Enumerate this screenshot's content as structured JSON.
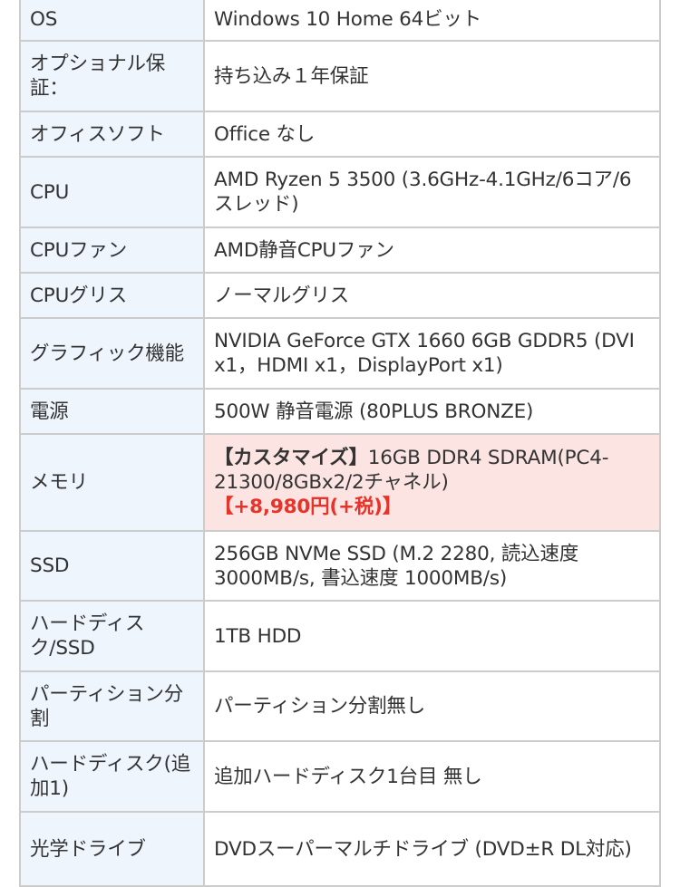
{
  "spec_table": {
    "colors": {
      "label_bg": "#eef5fd",
      "highlight_bg": "#fbe4e1",
      "price_red": "#e8332a",
      "border": "#cccccc"
    },
    "rows": [
      {
        "label": "OS",
        "value": "Windows 10 Home 64ビット"
      },
      {
        "label": "オプショナル保証：",
        "value": "持ち込み１年保証"
      },
      {
        "label": "オフィスソフト",
        "value": "Office なし"
      },
      {
        "label": "CPU",
        "value": "AMD Ryzen 5 3500 (3.6GHz-4.1GHz/6コア/6スレッド)"
      },
      {
        "label": "CPUファン",
        "value": "AMD静音CPUファン"
      },
      {
        "label": "CPUグリス",
        "value": "ノーマルグリス"
      },
      {
        "label": "グラフィック機能",
        "value": "NVIDIA GeForce GTX 1660 6GB GDDR5 (DVI x1，HDMI x1，DisplayPort x1)"
      },
      {
        "label": "電源",
        "value": "500W 静音電源 (80PLUS BRONZE)"
      },
      {
        "label": "メモリ",
        "customize_tag": "【カスタマイズ】",
        "value": "16GB DDR4 SDRAM(PC4-21300/8GBx2/2チャネル)",
        "price": "【+8,980円(+税)】",
        "highlighted": true
      },
      {
        "label": "SSD",
        "value": "256GB NVMe SSD (M.2 2280, 読込速度 3000MB/s, 書込速度 1000MB/s)"
      },
      {
        "label": "ハードディスク/SSD",
        "value": "1TB HDD"
      },
      {
        "label": "パーティション分割",
        "value": "パーティション分割無し"
      },
      {
        "label": "ハードディスク(追加1)",
        "value": "追加ハードディスク1台目 無し"
      },
      {
        "label": "光学ドライブ",
        "value": "DVDスーパーマルチドライブ (DVD±R DL対応)"
      }
    ]
  }
}
